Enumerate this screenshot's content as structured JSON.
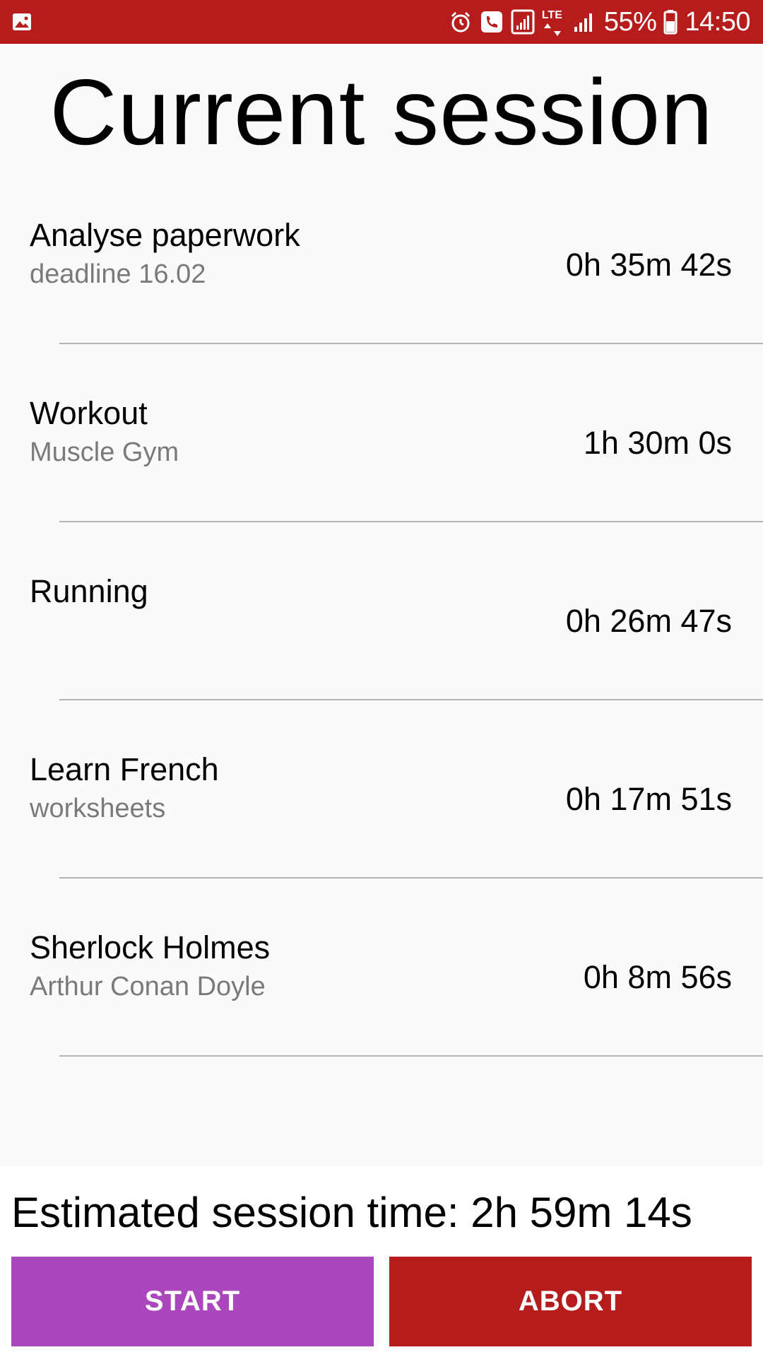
{
  "status_bar": {
    "background": "#b71c1c",
    "left_icon": "image-icon",
    "right_icons": [
      "alarm-icon",
      "call-icon",
      "sim-signal-icon",
      "lte-data-icon",
      "signal-icon",
      "battery-icon"
    ],
    "network_label": "LTE",
    "battery": "55%",
    "time": "14:50"
  },
  "title": "Current session",
  "tasks": [
    {
      "name": "Analyse paperwork",
      "note": "deadline 16.02",
      "duration": "0h 35m 42s"
    },
    {
      "name": "Workout",
      "note": "Muscle Gym",
      "duration": "1h 30m 0s"
    },
    {
      "name": "Running",
      "note": "",
      "duration": "0h 26m 47s"
    },
    {
      "name": "Learn French",
      "note": "worksheets",
      "duration": "0h 17m 51s"
    },
    {
      "name": "Sherlock Holmes",
      "note": "Arthur Conan Doyle",
      "duration": "0h 8m 56s"
    }
  ],
  "footer": {
    "estimate": "Estimated session time: 2h 59m 14s",
    "start_label": "START",
    "abort_label": "ABORT",
    "start_color": "#ab47bc",
    "abort_color": "#b71c1c"
  }
}
